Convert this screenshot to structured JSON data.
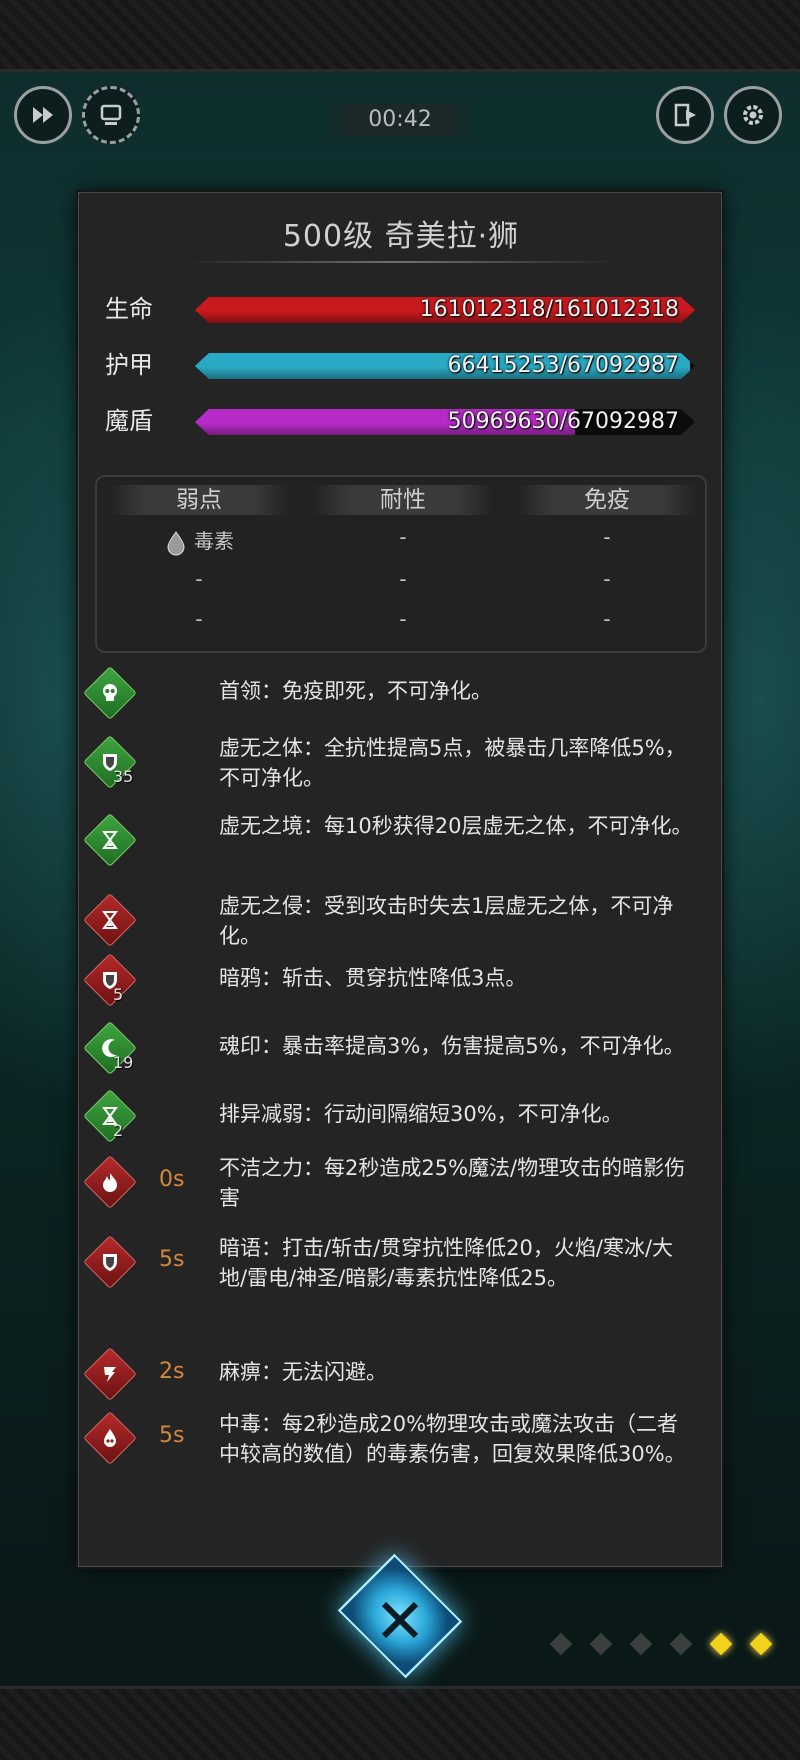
{
  "hud": {
    "timer": "00:42",
    "buttons": [
      "fast-forward-icon",
      "auto-battle-icon",
      "exit-icon",
      "gear-icon"
    ]
  },
  "panel": {
    "title": "500级  奇美拉·狮"
  },
  "stats": [
    {
      "label": "生命",
      "value": "161012318/161012318",
      "fill": 1.0,
      "color": "#c8191e"
    },
    {
      "label": "护甲",
      "value": "66415253/67092987",
      "fill": 0.99,
      "color": "#2aa9c4"
    },
    {
      "label": "魔盾",
      "value": "50969630/67092987",
      "fill": 0.76,
      "color": "#b62bc7"
    }
  ],
  "resist": {
    "headers": [
      "弱点",
      "耐性",
      "免疫"
    ],
    "weak": [
      "毒素",
      "-",
      "-"
    ],
    "resist": [
      "-",
      "-",
      "-"
    ],
    "immune": [
      "-",
      "-",
      "-"
    ],
    "weak_icon": "poison-drop-icon"
  },
  "effects": [
    {
      "icon": "skull-icon",
      "color": "green",
      "count": "",
      "time": "",
      "text": "首领：免疫即死，不可净化。"
    },
    {
      "icon": "shield-icon",
      "color": "green",
      "count": "35",
      "time": "",
      "text": "虚无之体：全抗性提高5点，被暴击几率降低5%，不可净化。"
    },
    {
      "icon": "hourglass-icon",
      "color": "green",
      "count": "",
      "time": "",
      "text": "虚无之境：每10秒获得20层虚无之体，不可净化。"
    },
    {
      "icon": "hourglass-icon",
      "color": "red",
      "count": "",
      "time": "",
      "text": "虚无之侵：受到攻击时失去1层虚无之体，不可净化。"
    },
    {
      "icon": "shield-icon",
      "color": "red",
      "count": "5",
      "time": "",
      "text": "暗鸦：斩击、贯穿抗性降低3点。"
    },
    {
      "icon": "crescent-icon",
      "color": "green",
      "count": "19",
      "time": "",
      "text": "魂印：暴击率提高3%，伤害提高5%，不可净化。"
    },
    {
      "icon": "hourglass-icon",
      "color": "green",
      "count": "2",
      "time": "",
      "text": "排异减弱：行动间隔缩短30%，不可净化。"
    },
    {
      "icon": "flame-icon",
      "color": "red",
      "count": "",
      "time": "0s",
      "text": "不洁之力：每2秒造成25%魔法/物理攻击的暗影伤害"
    },
    {
      "icon": "shield-icon",
      "color": "red",
      "count": "",
      "time": "5s",
      "text": "暗语：打击/斩击/贯穿抗性降低20，火焰/寒冰/大地/雷电/神圣/暗影/毒素抗性降低25。"
    },
    {
      "icon": "paralysis-icon",
      "color": "red",
      "count": "",
      "time": "2s",
      "text": "麻痹：无法闪避。"
    },
    {
      "icon": "poison-drop-icon",
      "color": "red",
      "count": "",
      "time": "5s",
      "text": "中毒：每2秒造成20%物理攻击或魔法攻击（二者中较高的数值）的毒素伤害，回复效果降低30%。"
    }
  ],
  "footer": {
    "close_icon": "close-icon",
    "pager_dots": 6,
    "active_dots": [
      4,
      5
    ]
  }
}
